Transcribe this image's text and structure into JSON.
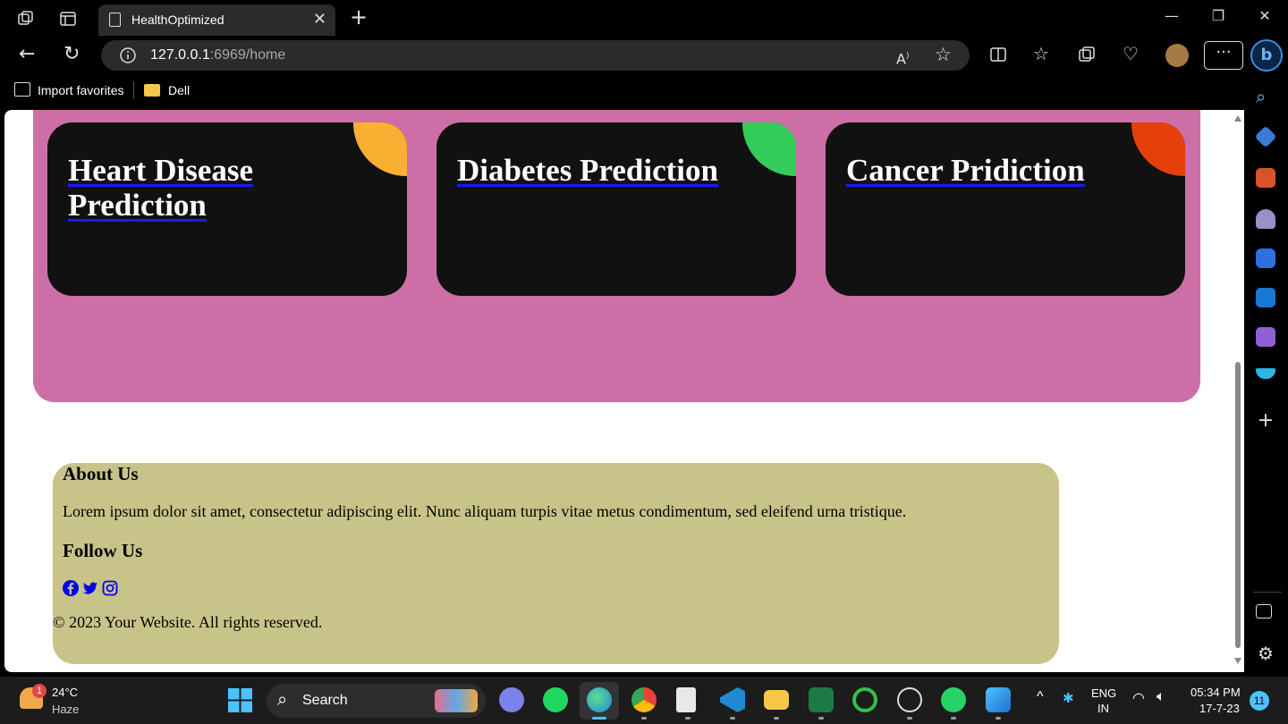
{
  "browser": {
    "tab_title": "HealthOptimized",
    "url_host": "127.0.0.1",
    "url_rest": ":6969/home",
    "favorites": [
      "Import favorites",
      "Dell"
    ]
  },
  "cards": [
    {
      "title": "Heart Disease Prediction",
      "accent": "#f9b032"
    },
    {
      "title": "Diabetes Prediction",
      "accent": "#33cc5a"
    },
    {
      "title": "Cancer Pridiction",
      "accent": "#e5400c"
    }
  ],
  "colors": {
    "hero_bg": "#cd6fa6",
    "footer_bg": "#c8c389",
    "card_bg": "#111111"
  },
  "footer": {
    "about_heading": "About Us",
    "about_text": "Lorem ipsum dolor sit amet, consectetur adipiscing elit. Nunc aliquam turpis vitae metus condimentum, sed eleifend urna tristique.",
    "follow_heading": "Follow Us",
    "social_icons": [
      "facebook-icon",
      "twitter-icon",
      "instagram-icon"
    ],
    "copyright": "© 2023 Your Website. All rights reserved."
  },
  "taskbar": {
    "weather_temp": "24°C",
    "weather_desc": "Haze",
    "weather_badge": "1",
    "search_label": "Search",
    "lang_top": "ENG",
    "lang_bottom": "IN",
    "time": "05:34 PM",
    "date": "17-7-23",
    "notif_count": "11"
  }
}
